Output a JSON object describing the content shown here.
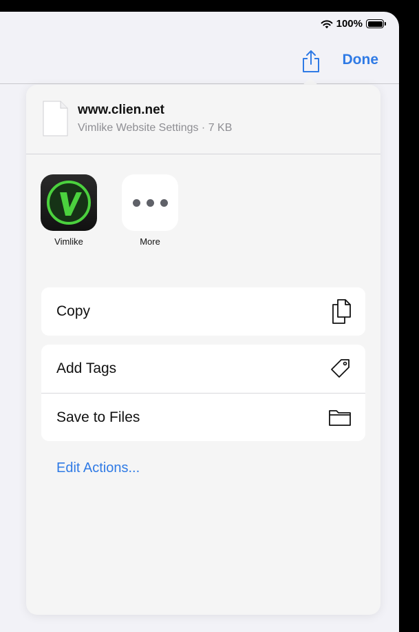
{
  "status_bar": {
    "battery_percent": "100%",
    "battery_level": 1.0
  },
  "nav": {
    "done_label": "Done"
  },
  "file": {
    "name": "www.clien.net",
    "subtitle": "Vimlike Website Settings · 7 KB"
  },
  "apps": [
    {
      "label": "Vimlike",
      "icon": "vimlike-app-icon"
    },
    {
      "label": "More",
      "icon": "more-dots-icon"
    }
  ],
  "actions": {
    "copy": {
      "label": "Copy",
      "icon": "copy-icon"
    },
    "add_tags": {
      "label": "Add Tags",
      "icon": "tag-icon"
    },
    "save_to_files": {
      "label": "Save to Files",
      "icon": "folder-icon"
    }
  },
  "edit_actions_label": "Edit Actions...",
  "colors": {
    "accent": "#2f7ae5",
    "vimlike_green": "#4bd13e",
    "background": "#f2f2f7"
  }
}
